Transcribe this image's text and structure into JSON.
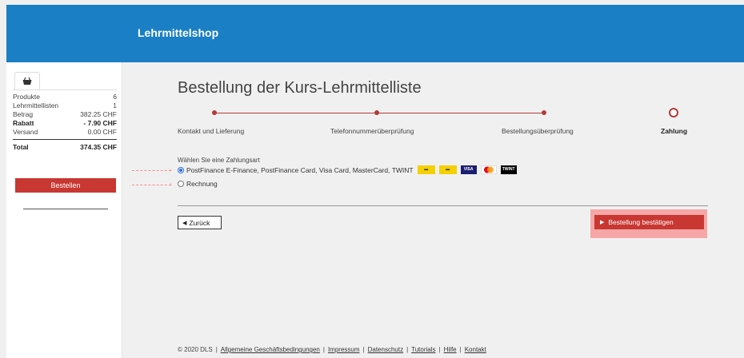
{
  "header": {
    "title": "Lehrmittelshop"
  },
  "sidebar": {
    "cart_icon": "basket-icon",
    "rows": [
      {
        "label": "Produkte",
        "value": "6",
        "bold": false
      },
      {
        "label": "Lehrmittellisten",
        "value": "1",
        "bold": false
      },
      {
        "label": "Betrag",
        "value": "382.25 CHF",
        "bold": false
      },
      {
        "label": "Rabatt",
        "value": "- 7.90 CHF",
        "bold": true
      },
      {
        "label": "Versand",
        "value": "0.00 CHF",
        "bold": false
      }
    ],
    "total_label": "Total",
    "total_value": "374.35 CHF",
    "order_button": "Bestellen"
  },
  "main": {
    "title": "Bestellung der Kurs-Lehrmittelliste",
    "steps": [
      {
        "label": "Kontakt und Lieferung",
        "active": false
      },
      {
        "label": "Telefonnummerüberprüfung",
        "active": false
      },
      {
        "label": "Bestellungsüberprüfung",
        "active": false
      },
      {
        "label": "Zahlung",
        "active": true
      }
    ],
    "payment_title": "Wählen Sie eine Zahlungsart",
    "payment_options": [
      {
        "label": "PostFinance E-Finance, PostFinance Card, Visa Card, MasterCard, TWINT",
        "checked": true
      },
      {
        "label": "Rechnung",
        "checked": false
      }
    ],
    "payment_logos": [
      {
        "name": "postfinance-efinance-logo",
        "color": "#f5d000"
      },
      {
        "name": "postfinance-card-logo",
        "color": "#f5d000"
      },
      {
        "name": "visa-logo",
        "label": "VISA",
        "color": "#1a1f71"
      },
      {
        "name": "mastercard-logo",
        "color": "#ea001b"
      },
      {
        "name": "twint-logo",
        "label": "TWINT",
        "color": "#000000"
      }
    ],
    "back_button": "Zurück",
    "confirm_button": "Bestellung bestätigen"
  },
  "footer": {
    "copyright": "© 2020 DLS",
    "links": [
      "Allgemeine Geschäftsbedingungen",
      "Impressum",
      "Datenschutz",
      "Tutorials",
      "Hilfe",
      "Kontakt"
    ]
  },
  "colors": {
    "header": "#1a7fc4",
    "accent": "#c83732",
    "highlight": "#f6a6a6"
  }
}
